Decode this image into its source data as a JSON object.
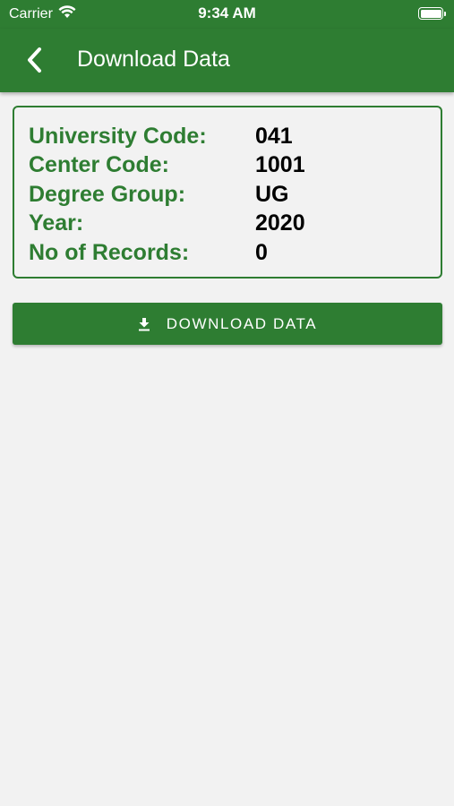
{
  "status_bar": {
    "carrier": "Carrier",
    "time": "9:34 AM"
  },
  "app_bar": {
    "title": "Download Data"
  },
  "info": [
    {
      "label": "University Code:",
      "value": "041"
    },
    {
      "label": "Center Code:",
      "value": "1001"
    },
    {
      "label": "Degree Group:",
      "value": "UG"
    },
    {
      "label": "Year:",
      "value": "2020"
    },
    {
      "label": "No of Records:",
      "value": "0"
    }
  ],
  "download_button": {
    "label": "DOWNLOAD DATA"
  },
  "colors": {
    "primary": "#2e7d32",
    "background": "#f2f2f2",
    "value_text": "#000000"
  }
}
